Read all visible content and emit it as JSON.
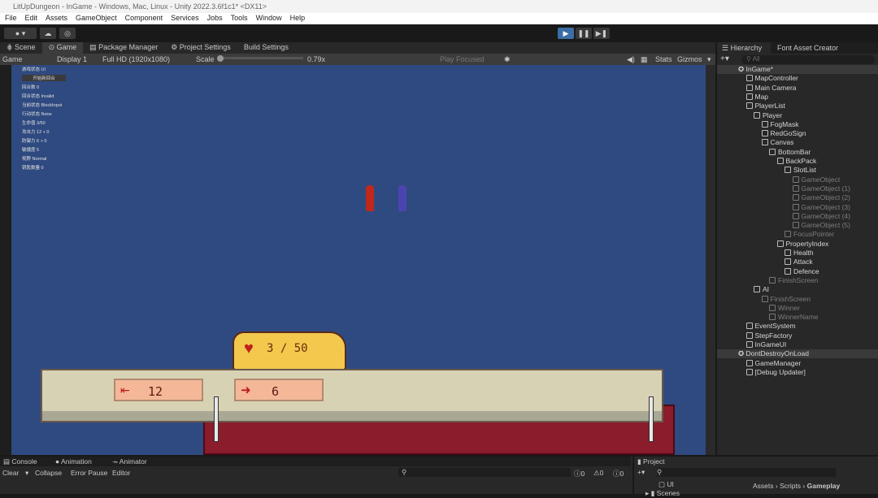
{
  "window": {
    "title": "LitUpDungeon - InGame - Windows, Mac, Linux - Unity 2022.3.6f1c1* <DX11>"
  },
  "menu": [
    "File",
    "Edit",
    "Assets",
    "GameObject",
    "Component",
    "Services",
    "Jobs",
    "Tools",
    "Window",
    "Help"
  ],
  "tabs": [
    "Scene",
    "Game",
    "Package Manager",
    "Project Settings",
    "Build Settings"
  ],
  "gamebar": {
    "mode": "Game",
    "display": "Display 1",
    "resolution": "Full HD (1920x1080)",
    "scale_label": "Scale",
    "scale": "0.79x",
    "play_focused": "Play Focused",
    "stats": "Stats",
    "gizmos": "Gizmos"
  },
  "debug": [
    "游戏状态 UI",
    "开始新回合",
    "回合数 0",
    "回合状态 Invalid",
    "当前状态 BlockInput",
    "行动状态 None",
    "生命值 3/50",
    "攻击力 12 + 0",
    "防御力 6 + 0",
    "敏捷度 5",
    "视野 Normal",
    "钥匙数量 0"
  ],
  "hud": {
    "health": "3 / 50",
    "attack": "12",
    "defence": "6"
  },
  "hierarchy": {
    "tabs": [
      "Hierarchy",
      "Font Asset Creator"
    ],
    "search": "All",
    "items": [
      {
        "label": "InGame*",
        "depth": 0,
        "type": "scene"
      },
      {
        "label": "MapController",
        "depth": 1
      },
      {
        "label": "Main Camera",
        "depth": 1
      },
      {
        "label": "Map",
        "depth": 1
      },
      {
        "label": "PlayerList",
        "depth": 1
      },
      {
        "label": "Player",
        "depth": 2
      },
      {
        "label": "FogMask",
        "depth": 3
      },
      {
        "label": "RedGoSign",
        "depth": 3
      },
      {
        "label": "Canvas",
        "depth": 3
      },
      {
        "label": "BottomBar",
        "depth": 4
      },
      {
        "label": "BackPack",
        "depth": 5
      },
      {
        "label": "SlotList",
        "depth": 6
      },
      {
        "label": "GameObject",
        "depth": 7,
        "dim": true
      },
      {
        "label": "GameObject (1)",
        "depth": 7,
        "dim": true
      },
      {
        "label": "GameObject (2)",
        "depth": 7,
        "dim": true
      },
      {
        "label": "GameObject (3)",
        "depth": 7,
        "dim": true
      },
      {
        "label": "GameObject (4)",
        "depth": 7,
        "dim": true
      },
      {
        "label": "GameObject (5)",
        "depth": 7,
        "dim": true
      },
      {
        "label": "FocusPointer",
        "depth": 6,
        "dim": true
      },
      {
        "label": "PropertyIndex",
        "depth": 5
      },
      {
        "label": "Health",
        "depth": 6
      },
      {
        "label": "Attack",
        "depth": 6
      },
      {
        "label": "Defence",
        "depth": 6
      },
      {
        "label": "FinishScreen",
        "depth": 4,
        "dim": true
      },
      {
        "label": "AI",
        "depth": 2
      },
      {
        "label": "FinishScreen",
        "depth": 3,
        "dim": true
      },
      {
        "label": "Winner",
        "depth": 4,
        "dim": true
      },
      {
        "label": "WinnerName",
        "depth": 4,
        "dim": true
      },
      {
        "label": "EventSystem",
        "depth": 1
      },
      {
        "label": "StepFactory",
        "depth": 1
      },
      {
        "label": "InGameUI",
        "depth": 1
      },
      {
        "label": "DontDestroyOnLoad",
        "depth": 0,
        "type": "scene"
      },
      {
        "label": "GameManager",
        "depth": 1
      },
      {
        "label": "[Debug Updater]",
        "depth": 1
      }
    ]
  },
  "console": {
    "tabs": [
      "Console",
      "Animation",
      "Animator"
    ],
    "clear": "Clear",
    "collapse": "Collapse",
    "error_pause": "Error Pause",
    "editor": "Editor",
    "counts": [
      "0",
      "0",
      "0"
    ]
  },
  "project": {
    "tab": "Project",
    "folders": [
      "UI",
      "Scenes"
    ],
    "breadcrumb": [
      "Assets",
      "Scripts",
      "Gameplay"
    ]
  }
}
